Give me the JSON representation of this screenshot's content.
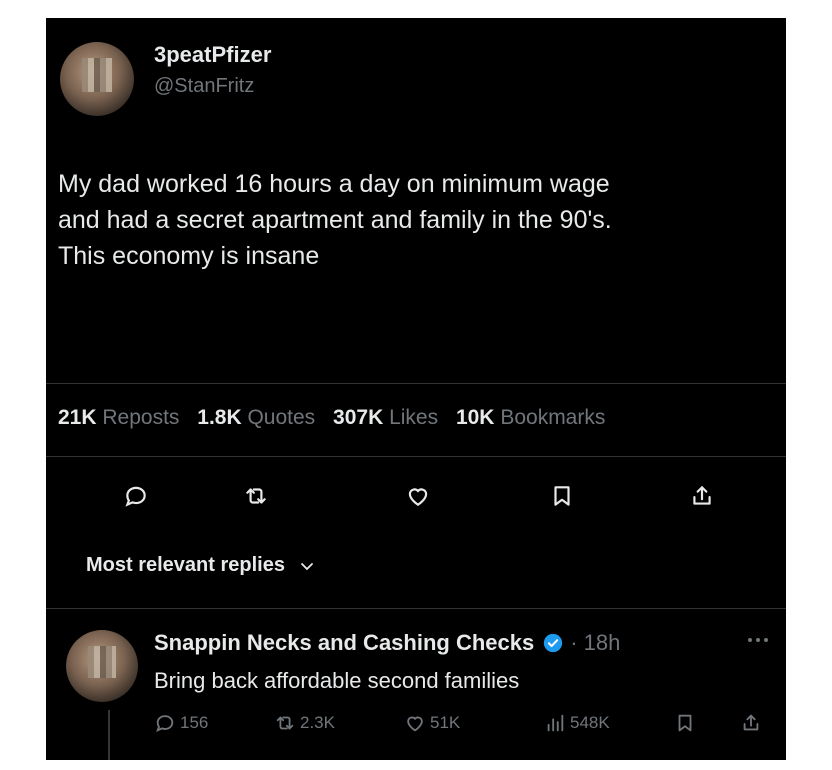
{
  "tweet": {
    "author_name": "3peatPfizer",
    "author_handle": "@StanFritz",
    "text": "My dad worked 16 hours a day on minimum wage\nand had a secret apartment and family in the 90's.\nThis economy is insane"
  },
  "stats": [
    {
      "value": "21K",
      "label": "Reposts"
    },
    {
      "value": "1.8K",
      "label": "Quotes"
    },
    {
      "value": "307K",
      "label": "Likes"
    },
    {
      "value": "10K",
      "label": "Bookmarks"
    }
  ],
  "actions": {
    "icons": [
      "reply-icon",
      "repost-icon",
      "like-icon",
      "bookmark-icon",
      "share-icon"
    ]
  },
  "replies_header": {
    "label": "Most relevant replies"
  },
  "reply": {
    "author_name": "Snappin Necks and Cashing Checks",
    "time": "· 18h",
    "text": "Bring back affordable second families",
    "counts": {
      "replies": "156",
      "reposts": "2.3K",
      "likes": "51K",
      "views": "548K"
    }
  },
  "colors": {
    "background": "#000000",
    "text_primary": "#e7e9ea",
    "text_secondary": "#71767b",
    "verified_blue": "#1d9bf0",
    "divider": "#2f3336"
  }
}
